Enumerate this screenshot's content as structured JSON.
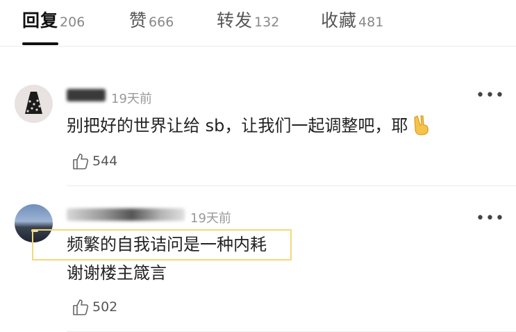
{
  "tabs": [
    {
      "label": "回复",
      "count": "206"
    },
    {
      "label": "赞",
      "count": "666"
    },
    {
      "label": "转发",
      "count": "132"
    },
    {
      "label": "收藏",
      "count": "481"
    }
  ],
  "comments": [
    {
      "time": "19天前",
      "text": "别把好的世界让给 sb，让我们一起调整吧，耶",
      "likes": "544",
      "emoji": "victory-hand"
    },
    {
      "time": "19天前",
      "line1": "频繁的自我诘问是一种内耗",
      "line2": "谢谢楼主箴言",
      "likes": "502"
    }
  ],
  "icons": {
    "more": "more-dots-icon",
    "like": "thumbs-up-icon"
  },
  "colors": {
    "highlight_border": "#f2d97a",
    "active_tab": "#111111",
    "muted_text": "#999999"
  }
}
